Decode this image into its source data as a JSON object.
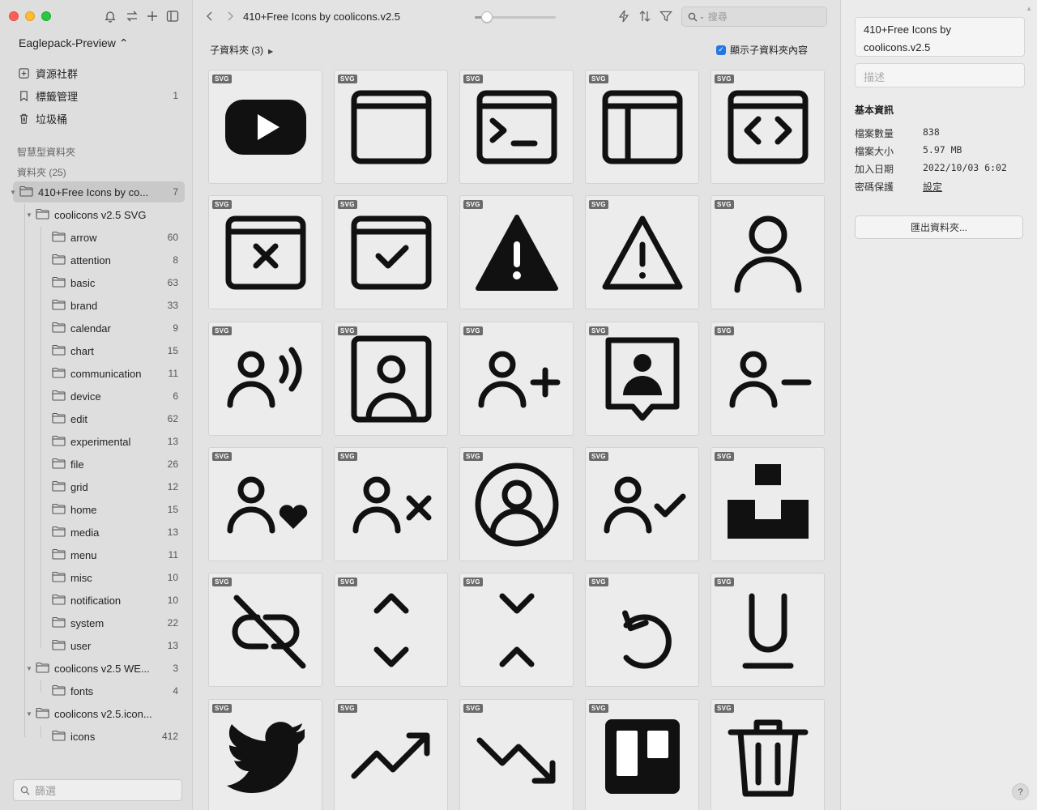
{
  "window": {
    "title": "410+Free Icons by coolicons.v2.5"
  },
  "sidebar": {
    "library_name": "Eaglepack-Preview ⌃",
    "nav": [
      {
        "label": "資源社群",
        "count": "",
        "icon": "community-icon"
      },
      {
        "label": "標籤管理",
        "count": "1",
        "icon": "bookmark-icon"
      },
      {
        "label": "垃圾桶",
        "count": "",
        "icon": "trash-icon"
      }
    ],
    "smart_folders_label": "智慧型資料夾",
    "folders_label": "資料夾 (25)",
    "tree": [
      {
        "label": "410+Free Icons by co...",
        "count": "7",
        "level": 0,
        "expanded": true,
        "selected": true
      },
      {
        "label": "coolicons v2.5 SVG",
        "count": "",
        "level": 1,
        "expanded": true
      },
      {
        "label": "arrow",
        "count": "60",
        "level": 2
      },
      {
        "label": "attention",
        "count": "8",
        "level": 2
      },
      {
        "label": "basic",
        "count": "63",
        "level": 2
      },
      {
        "label": "brand",
        "count": "33",
        "level": 2
      },
      {
        "label": "calendar",
        "count": "9",
        "level": 2
      },
      {
        "label": "chart",
        "count": "15",
        "level": 2
      },
      {
        "label": "communication",
        "count": "11",
        "level": 2
      },
      {
        "label": "device",
        "count": "6",
        "level": 2
      },
      {
        "label": "edit",
        "count": "62",
        "level": 2
      },
      {
        "label": "experimental",
        "count": "13",
        "level": 2
      },
      {
        "label": "file",
        "count": "26",
        "level": 2
      },
      {
        "label": "grid",
        "count": "12",
        "level": 2
      },
      {
        "label": "home",
        "count": "15",
        "level": 2
      },
      {
        "label": "media",
        "count": "13",
        "level": 2
      },
      {
        "label": "menu",
        "count": "11",
        "level": 2
      },
      {
        "label": "misc",
        "count": "10",
        "level": 2
      },
      {
        "label": "notification",
        "count": "10",
        "level": 2
      },
      {
        "label": "system",
        "count": "22",
        "level": 2
      },
      {
        "label": "user",
        "count": "13",
        "level": 2
      },
      {
        "label": "coolicons v2.5 WE...",
        "count": "3",
        "level": 1,
        "expanded": true
      },
      {
        "label": "fonts",
        "count": "4",
        "level": 2
      },
      {
        "label": "coolicons v2.5.icon...",
        "count": "",
        "level": 1,
        "expanded": true
      },
      {
        "label": "icons",
        "count": "412",
        "level": 2
      }
    ],
    "filter_placeholder": "篩選"
  },
  "toolbar": {
    "title": "410+Free Icons by coolicons.v2.5",
    "zoom_level": 0.15,
    "search_placeholder": "搜尋"
  },
  "subheader": {
    "subfolders_label": "子資料夾 (3)",
    "show_subfolder_content_label": "顯示子資料夾內容",
    "show_subfolder_content_checked": true
  },
  "grid": {
    "badge_label": "SVG",
    "items": [
      "youtube-icon",
      "window-icon",
      "terminal-icon",
      "sidebar-layout-icon",
      "code-window-icon",
      "window-close-icon",
      "window-check-icon",
      "warning-filled-icon",
      "warning-outline-icon",
      "user-icon",
      "user-voice-icon",
      "user-square-icon",
      "user-add-icon",
      "user-chat-icon",
      "user-remove-icon",
      "user-heart-icon",
      "user-close-icon",
      "user-circle-icon",
      "user-check-icon",
      "unsplash-icon",
      "unlink-icon",
      "unfold-icon",
      "fold-icon",
      "undo-icon",
      "underline-icon",
      "twitter-icon",
      "trending-up-icon",
      "trending-down-icon",
      "trello-icon",
      "trash-icon"
    ]
  },
  "inspector": {
    "name": "410+Free Icons by coolicons.v2.5",
    "desc_placeholder": "描述",
    "basic_info_heading": "基本資訊",
    "info": [
      {
        "key": "檔案數量",
        "value": "838"
      },
      {
        "key": "檔案大小",
        "value": "5.97 MB"
      },
      {
        "key": "加入日期",
        "value": "2022/10/03 6:02"
      },
      {
        "key": "密碼保護",
        "value": "設定",
        "link": true
      }
    ],
    "export_label": "匯出資料夾...",
    "help_label": "?"
  },
  "colors": {
    "accent": "#2477e4",
    "selection": "#c9c9c9",
    "icon": "#111111"
  }
}
